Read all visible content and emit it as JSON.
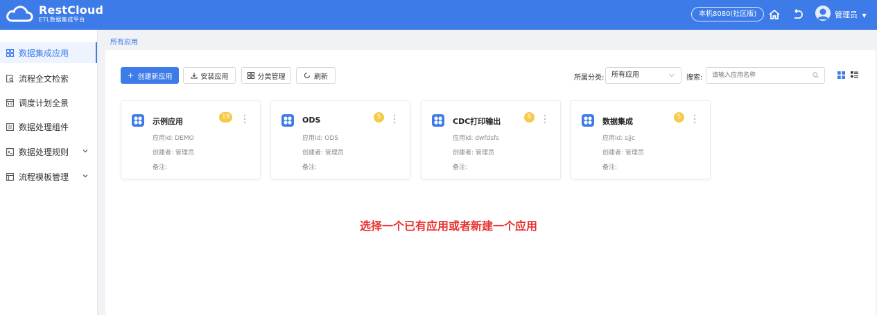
{
  "header": {
    "logo_title": "RestCloud",
    "logo_subtitle": "ETL数据集成平台",
    "env": "本机8080(社区版)",
    "user": "管理员",
    "home_icon": "home-icon",
    "back_icon": "undo-icon"
  },
  "sidebar": {
    "items": [
      {
        "label": "数据集成应用",
        "icon": "grid-icon",
        "active": true
      },
      {
        "label": "流程全文检索",
        "icon": "document-search-icon"
      },
      {
        "label": "调度计划全景",
        "icon": "calendar-icon"
      },
      {
        "label": "数据处理组件",
        "icon": "component-icon"
      },
      {
        "label": "数据处理规则",
        "icon": "rules-icon",
        "expandable": true
      },
      {
        "label": "流程模板管理",
        "icon": "template-icon",
        "expandable": true
      }
    ]
  },
  "breadcrumb": "所有应用",
  "toolbar": {
    "create": "创建新应用",
    "install": "安装应用",
    "category_manage": "分类管理",
    "refresh": "刷新",
    "category_label": "所属分类:",
    "category_value": "所有应用",
    "search_label": "搜索:",
    "search_placeholder": "请输入应用名称"
  },
  "cards": [
    {
      "title": "示例应用",
      "count": "19",
      "app_id": "应用Id: DEMO",
      "creator": "创建者: 管理员",
      "note": "备注:"
    },
    {
      "title": "ODS",
      "count": "5",
      "app_id": "应用Id: ODS",
      "creator": "创建者: 管理员",
      "note": "备注:"
    },
    {
      "title": "CDC打印输出",
      "count": "6",
      "app_id": "应用Id: dwfdsfs",
      "creator": "创建者: 管理员",
      "note": "备注:"
    },
    {
      "title": "数据集成",
      "count": "5",
      "app_id": "应用Id: sjjc",
      "creator": "创建者: 管理员",
      "note": "备注:"
    }
  ],
  "hint": "选择一个已有应用或者新建一个应用",
  "colors": {
    "primary": "#3d7be8",
    "badge": "#f7c948",
    "hint": "#e8312f"
  }
}
